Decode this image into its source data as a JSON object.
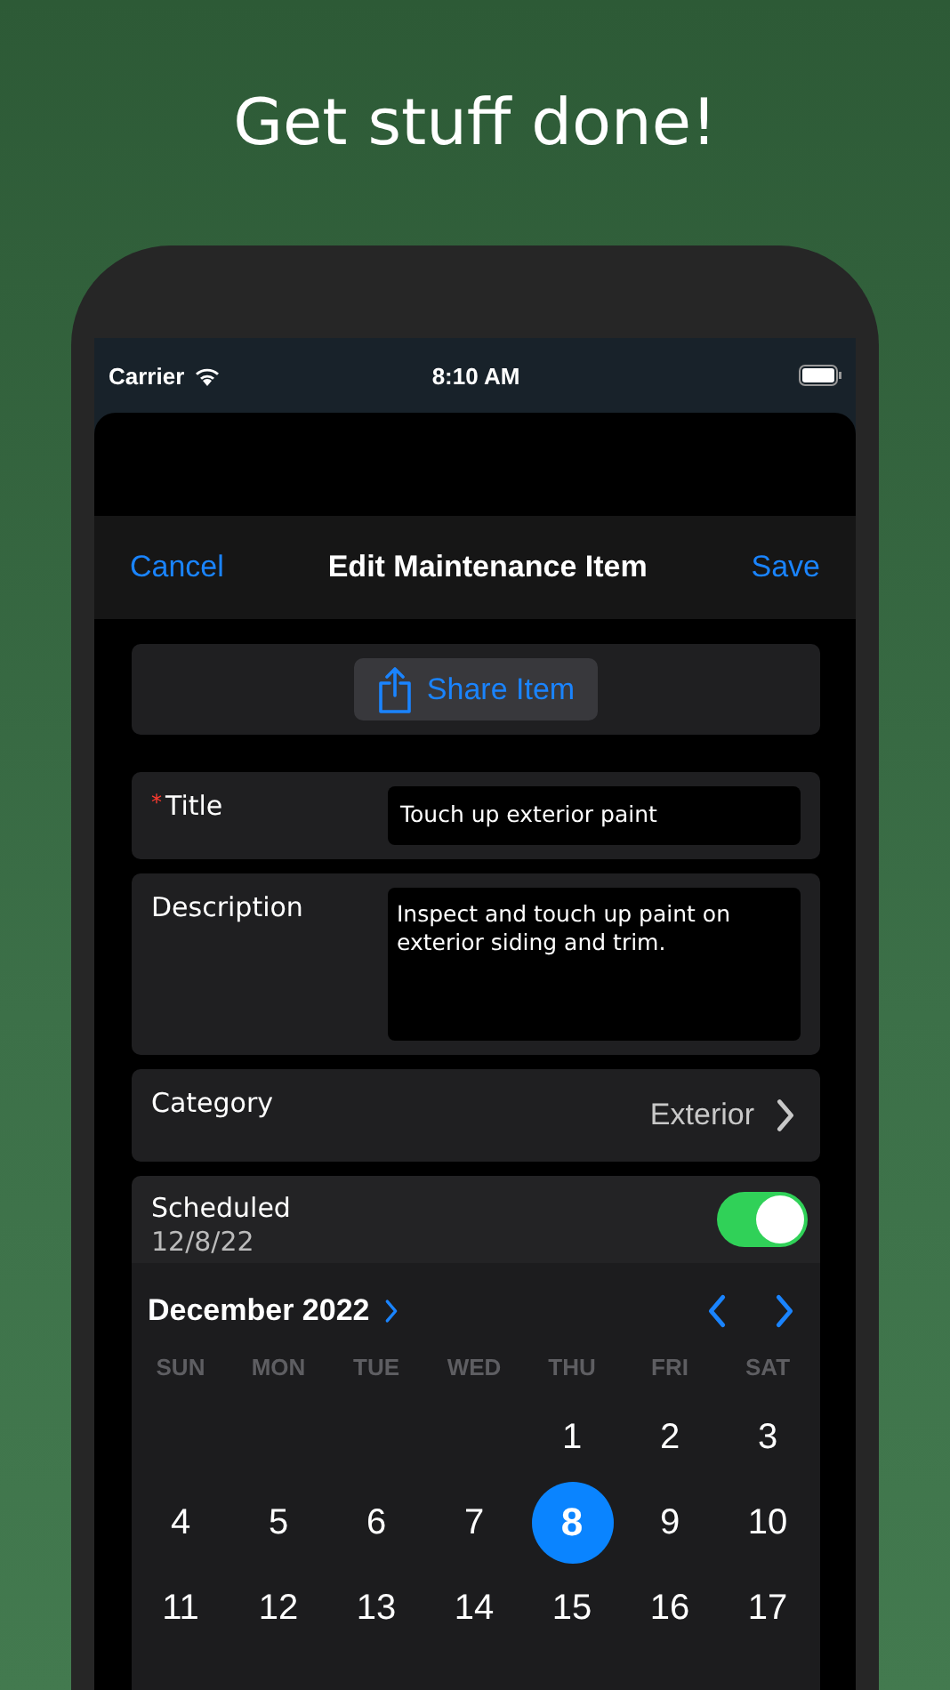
{
  "headline": "Get stuff done!",
  "status_bar": {
    "carrier": "Carrier",
    "time": "8:10 AM"
  },
  "nav": {
    "cancel": "Cancel",
    "title": "Edit Maintenance Item",
    "save": "Save"
  },
  "share_button": {
    "label": "Share Item"
  },
  "fields": [
    {
      "kind": "text",
      "label": "Title",
      "required_mark": "*",
      "value": "Touch up exterior paint"
    },
    {
      "kind": "textarea",
      "label": "Description",
      "value": "Inspect and touch up paint on exterior siding and trim."
    },
    {
      "kind": "picker",
      "label": "Category",
      "value": "Exterior"
    }
  ],
  "scheduled": {
    "label": "Scheduled",
    "date": "12/8/22",
    "on": true
  },
  "calendar": {
    "month": "December 2022",
    "weekdays": [
      "SUN",
      "MON",
      "TUE",
      "WED",
      "THU",
      "FRI",
      "SAT"
    ],
    "weeks": [
      {
        "kind": "first",
        "days": [
          {
            "label": "1",
            "selected": false
          },
          {
            "label": "2",
            "selected": false
          },
          {
            "label": "3",
            "selected": false
          }
        ]
      },
      {
        "kind": "full",
        "days": [
          {
            "label": "4",
            "selected": false
          },
          {
            "label": "5",
            "selected": false
          },
          {
            "label": "6",
            "selected": false
          },
          {
            "label": "7",
            "selected": false
          },
          {
            "label": "8",
            "selected": true
          },
          {
            "label": "9",
            "selected": false
          },
          {
            "label": "10",
            "selected": false
          }
        ]
      },
      {
        "kind": "full",
        "days": [
          {
            "label": "11",
            "selected": false
          },
          {
            "label": "12",
            "selected": false
          },
          {
            "label": "13",
            "selected": false
          },
          {
            "label": "14",
            "selected": false
          },
          {
            "label": "15",
            "selected": false
          },
          {
            "label": "16",
            "selected": false
          },
          {
            "label": "17",
            "selected": false
          }
        ]
      }
    ]
  }
}
